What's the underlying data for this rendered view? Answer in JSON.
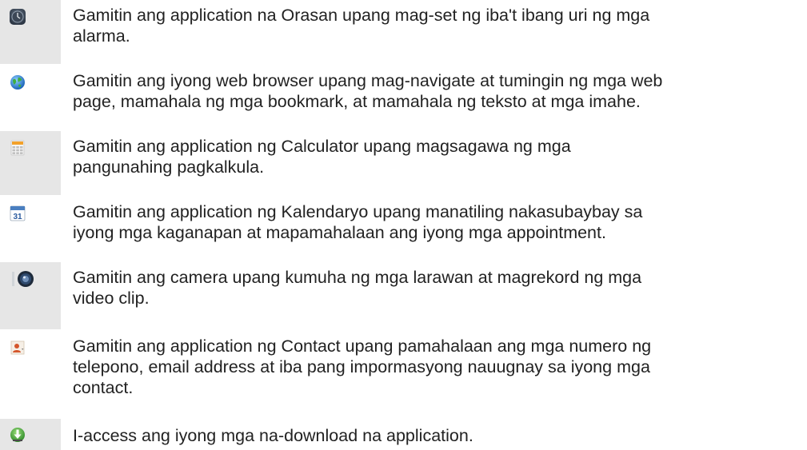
{
  "rows": [
    {
      "icon": "clock-icon",
      "lines": [
        "Gamitin ang application na Orasan upang mag-set ng iba't ibang uri ng mga",
        "alarma."
      ]
    },
    {
      "icon": "globe-browser-icon",
      "lines": [
        "Gamitin ang iyong web browser upang mag-navigate at tumingin ng mga web",
        "page, mamahala ng mga bookmark, at mamahala ng teksto at mga imahe."
      ]
    },
    {
      "icon": "calculator-icon",
      "lines": [
        "Gamitin ang application ng Calculator upang magsagawa ng mga",
        "pangunahing pagkalkula."
      ]
    },
    {
      "icon": "calendar-icon",
      "calendar_day": "31",
      "lines": [
        "Gamitin ang application ng Kalendaryo upang manatiling nakasubaybay sa",
        "iyong mga kaganapan at mapamahalaan ang iyong mga appointment."
      ]
    },
    {
      "icon": "camera-icon",
      "lines": [
        "Gamitin ang camera upang kumuha ng mga larawan at magrekord ng mga",
        "video clip."
      ]
    },
    {
      "icon": "contacts-icon",
      "lines": [
        "Gamitin ang application ng Contact upang pamahalaan ang mga numero ng",
        "telepono, email address at iba pang impormasyong nauugnay sa iyong mga",
        "contact."
      ]
    },
    {
      "icon": "download-icon",
      "lines": [
        "I-access ang iyong mga na-download na application."
      ]
    }
  ]
}
